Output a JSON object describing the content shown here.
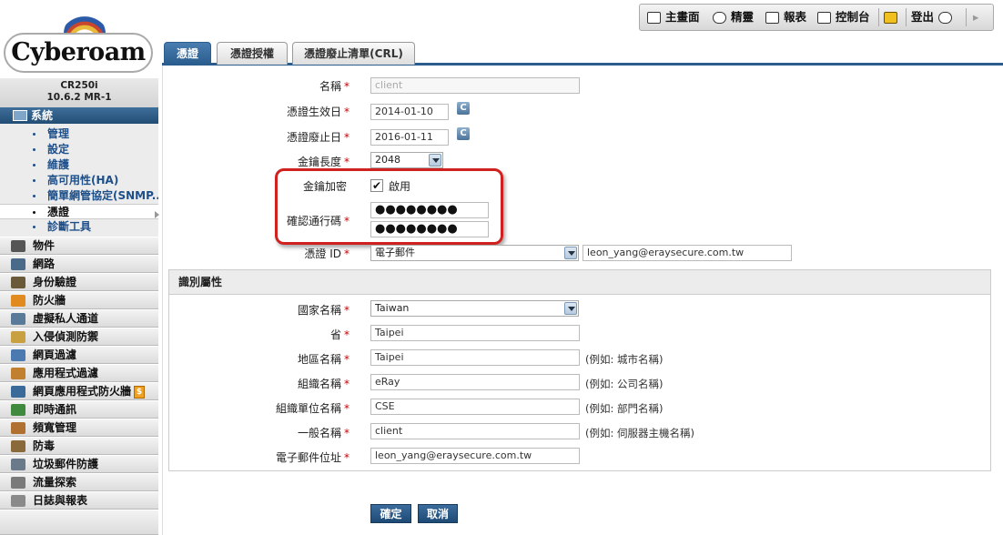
{
  "app": {
    "brand": "Cyberoam",
    "model": "CR250i",
    "version": "10.6.2 MR-1"
  },
  "topbar": {
    "dashboard": "主畫面",
    "wizard": "精靈",
    "reports": "報表",
    "console": "控制台",
    "logout": "登出"
  },
  "sidebar": {
    "system": "系統",
    "sub_items": [
      "管理",
      "設定",
      "維護",
      "高可用性(HA)",
      "簡單網管協定(SNMP...",
      "憑證",
      "診斷工具"
    ],
    "groups": [
      "物件",
      "網路",
      "身份驗證",
      "防火牆",
      "虛擬私人通道",
      "入侵偵測防禦",
      "網頁過濾",
      "應用程式過濾",
      "網頁應用程式防火牆",
      "即時通訊",
      "頻寬管理",
      "防毒",
      "垃圾郵件防護",
      "流量探索",
      "日誌與報表"
    ],
    "waf_badge": "$"
  },
  "tabs": [
    "憑證",
    "憑證授權",
    "憑證廢止清單(CRL)"
  ],
  "form": {
    "name_label": "名稱",
    "name_value": "client",
    "valid_from_label": "憑證生效日",
    "valid_from_value": "2014-01-10",
    "valid_to_label": "憑證廢止日",
    "valid_to_value": "2016-01-11",
    "cal_btn": "C",
    "key_length_label": "金鑰長度",
    "key_length_value": "2048",
    "key_enc_label": "金鑰加密",
    "key_enc_check": "✔",
    "key_enc_option": "啟用",
    "passphrase_label": "確認通行碼",
    "passphrase_value": "●●●●●●●●",
    "passphrase_confirm_value": "●●●●●●●●",
    "cert_id_label": "憑證 ID",
    "cert_id_type": "電子郵件",
    "cert_id_value": "leon_yang@eraysecure.com.tw",
    "req": "*"
  },
  "identity": {
    "header": "識別屬性",
    "country_label": "國家名稱",
    "country_value": "Taiwan",
    "province_label": "省",
    "province_value": "Taipei",
    "locality_label": "地區名稱",
    "locality_value": "Taipei",
    "locality_hint": "(例如: 城市名稱)",
    "org_label": "組織名稱",
    "org_value": "eRay",
    "org_hint": "(例如: 公司名稱)",
    "ou_label": "組織單位名稱",
    "ou_value": "CSE",
    "ou_hint": "(例如: 部門名稱)",
    "cn_label": "一般名稱",
    "cn_value": "client",
    "cn_hint": "(例如: 伺服器主機名稱)",
    "email_label": "電子郵件位址",
    "email_value": "leon_yang@eraysecure.com.tw"
  },
  "buttons": {
    "ok": "確定",
    "cancel": "取消"
  },
  "colors": {
    "accent": "#2a5d8e",
    "highlight": "#d02020",
    "link": "#1d4f8a"
  }
}
